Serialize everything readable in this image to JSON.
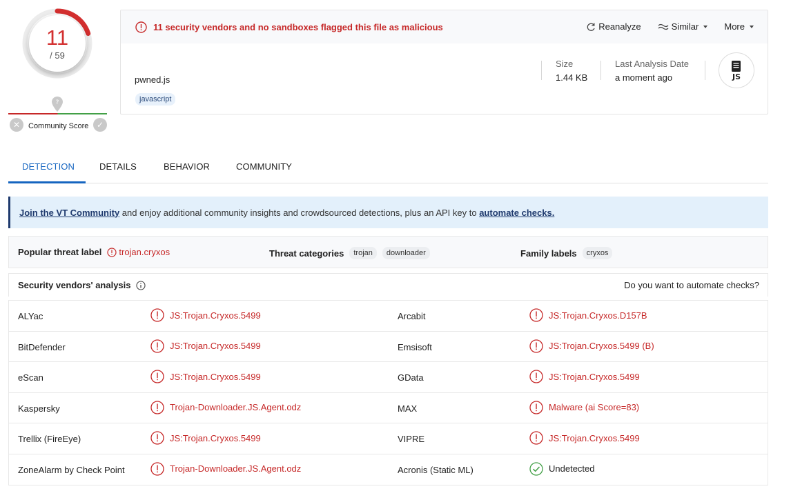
{
  "score": {
    "detected": "11",
    "total": "/ 59"
  },
  "community": {
    "label": "Community Score"
  },
  "header": {
    "alert": "11 security vendors and no sandboxes flagged this file as malicious",
    "actions": {
      "reanalyze": "Reanalyze",
      "similar": "Similar",
      "more": "More"
    },
    "file_name": "pwned.js",
    "file_tag": "javascript",
    "size_label": "Size",
    "size_value": "1.44 KB",
    "date_label": "Last Analysis Date",
    "date_value": "a moment ago",
    "file_type_icon_text": "JS"
  },
  "tabs": [
    "DETECTION",
    "DETAILS",
    "BEHAVIOR",
    "COMMUNITY"
  ],
  "join": {
    "link1": "Join the VT Community",
    "text": " and enjoy additional community insights and crowdsourced detections, plus an API key to ",
    "link2": "automate checks."
  },
  "threat": {
    "popular_label": "Popular threat label",
    "popular_value": "trojan.cryxos",
    "categories_label": "Threat categories",
    "categories": [
      "trojan",
      "downloader"
    ],
    "family_label": "Family labels",
    "families": [
      "cryxos"
    ]
  },
  "analysis": {
    "title": "Security vendors' analysis",
    "automate": "Do you want to automate checks?"
  },
  "vendors": [
    {
      "left": "ALYac",
      "left_result": "JS:Trojan.Cryxos.5499",
      "right": "Arcabit",
      "right_result": "JS:Trojan.Cryxos.D157B",
      "right_ok": false
    },
    {
      "left": "BitDefender",
      "left_result": "JS:Trojan.Cryxos.5499",
      "right": "Emsisoft",
      "right_result": "JS:Trojan.Cryxos.5499 (B)",
      "right_ok": false
    },
    {
      "left": "eScan",
      "left_result": "JS:Trojan.Cryxos.5499",
      "right": "GData",
      "right_result": "JS:Trojan.Cryxos.5499",
      "right_ok": false
    },
    {
      "left": "Kaspersky",
      "left_result": "Trojan-Downloader.JS.Agent.odz",
      "right": "MAX",
      "right_result": "Malware (ai Score=83)",
      "right_ok": false
    },
    {
      "left": "Trellix (FireEye)",
      "left_result": "JS:Trojan.Cryxos.5499",
      "right": "VIPRE",
      "right_result": "JS:Trojan.Cryxos.5499",
      "right_ok": false
    },
    {
      "left": "ZoneAlarm by Check Point",
      "left_result": "Trojan-Downloader.JS.Agent.odz",
      "right": "Acronis (Static ML)",
      "right_result": "Undetected",
      "right_ok": true
    }
  ],
  "colors": {
    "malicious": "#c62828",
    "accent": "#1565c0",
    "clean": "#43a047"
  }
}
